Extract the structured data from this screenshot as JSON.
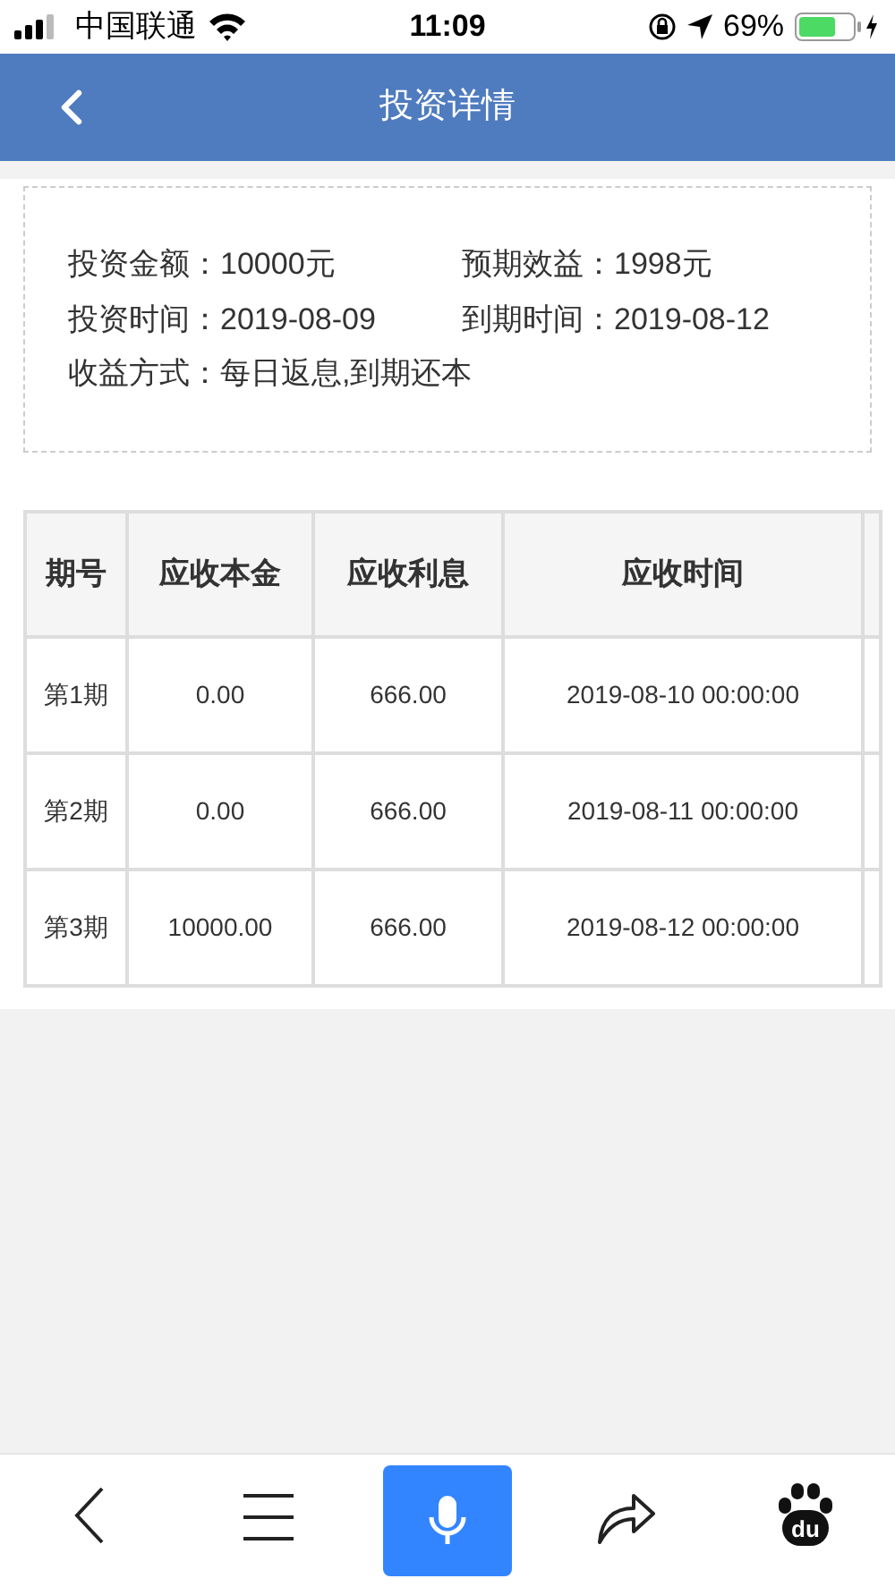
{
  "status_bar": {
    "carrier": "中国联通",
    "time": "11:09",
    "battery": "69%"
  },
  "header": {
    "title": "投资详情"
  },
  "summary": [
    {
      "label": "投资金额：",
      "value": "10000元"
    },
    {
      "label": "预期效益：",
      "value": "1998元"
    },
    {
      "label": "投资时间：",
      "value": "2019-08-09"
    },
    {
      "label": "到期时间：",
      "value": "2019-08-12"
    },
    {
      "label": "收益方式：",
      "value": "每日返息,到期还本"
    }
  ],
  "table": {
    "columns": [
      "期号",
      "应收本金",
      "应收利息",
      "应收时间"
    ],
    "rows": [
      [
        "第1期",
        "0.00",
        "666.00",
        "2019-08-10 00:00:00"
      ],
      [
        "第2期",
        "0.00",
        "666.00",
        "2019-08-11 00:00:00"
      ],
      [
        "第3期",
        "10000.00",
        "666.00",
        "2019-08-12 00:00:00"
      ]
    ]
  },
  "bottom_bar": {
    "logo_text": "du"
  }
}
